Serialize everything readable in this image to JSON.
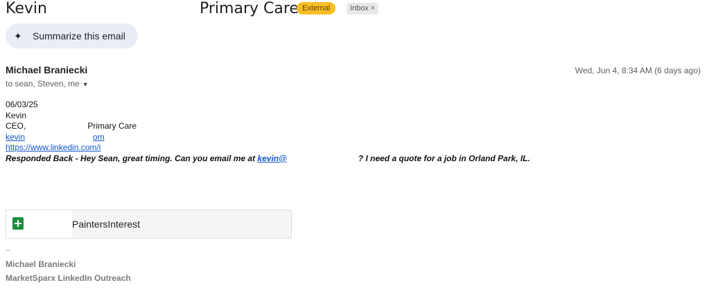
{
  "subject": {
    "left_text": "Kevin",
    "right_text": "Primary Care",
    "labels": {
      "external": "External",
      "inbox": "Inbox",
      "inbox_remove": "×"
    }
  },
  "summarize": {
    "icon": "sparkle-icon",
    "label": "Summarize this email"
  },
  "message": {
    "sender": "Michael Braniecki",
    "recipients": "to sean, Steven, me",
    "date": "Wed, Jun 4, 8:34 AM (6 days ago)",
    "body": {
      "date_line": "06/03/25",
      "name_line": "Kevin",
      "title_prefix": "CEO,",
      "title_suffix": "Primary Care",
      "email_start": "kevin",
      "email_end": "om",
      "linkedin": "https://www.linkedin.com/i",
      "response_part1": "Responded Back - Hey Sean, great timing. Can you email me at ",
      "response_link": "kevin@",
      "response_part2": "? I need a quote for a job in Orland Park, IL."
    },
    "attachment": {
      "icon": "google-sheets-icon",
      "name": "PaintersInterest"
    },
    "signature": {
      "dash": "--",
      "name": "Michael Braniecki",
      "company": "MarketSparx LinkedIn Outreach"
    }
  },
  "colors": {
    "external_label_bg": "#f6bf26",
    "link": "#1155cc",
    "summarize_bg": "#e9eef6",
    "sheets_green": "#1e8e3e"
  }
}
